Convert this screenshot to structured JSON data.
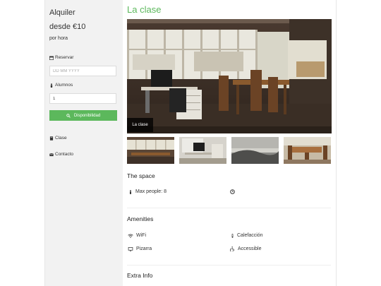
{
  "sidebar": {
    "title": "Alquiler",
    "price": "desde €10",
    "price_unit": "por hora",
    "reserve_label": "Reservar",
    "date_placeholder": "DD MM YYYY",
    "students_label": "Alumnos",
    "students_value": "1",
    "availability_label": "Disponibilidad",
    "links": [
      "Clase",
      "Contacto"
    ]
  },
  "main": {
    "title": "La clase",
    "hero_caption": "La clase",
    "space": {
      "heading": "The space",
      "max_people": "Max people: 8"
    },
    "amenities": {
      "heading": "Amenities",
      "items": [
        "WiFi",
        "Calefacción",
        "Pizarra",
        "Accessible"
      ]
    },
    "extra_heading": "Extra Info"
  },
  "colors": {
    "accent": "#5cb85c",
    "sidebar_bg": "#f2f2f2"
  }
}
